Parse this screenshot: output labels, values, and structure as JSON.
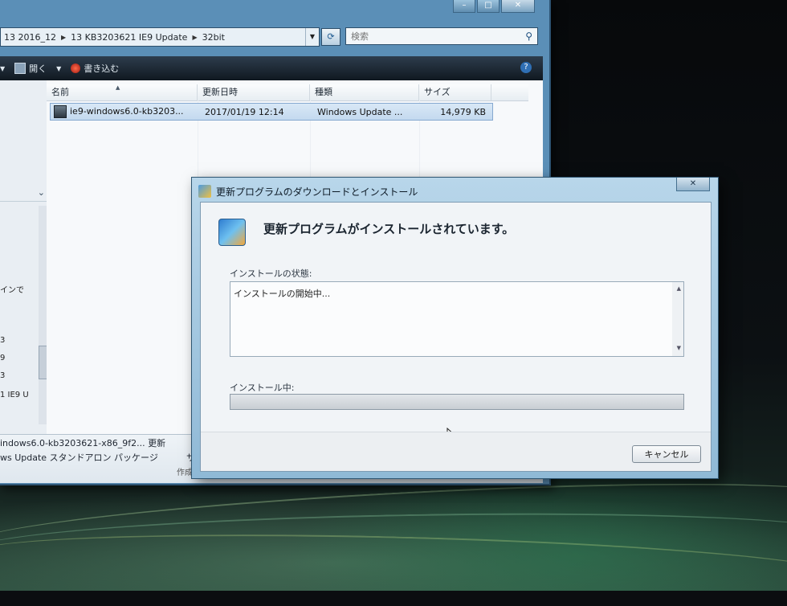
{
  "explorer": {
    "address": {
      "crumbs": [
        "13 2016_12",
        "13 KB3203621 IE9 Update",
        "32bit"
      ]
    },
    "search": {
      "placeholder": "検索"
    },
    "toolbar": {
      "open_label": "開く",
      "burn_label": "書き込む"
    },
    "columns": [
      "名前",
      "更新日時",
      "種類",
      "サイズ"
    ],
    "files": [
      {
        "name": "ie9-windows6.0-kb3203...",
        "modified": "2017/01/19 12:14",
        "type": "Windows Update ...",
        "size": "14,979 KB"
      }
    ],
    "nav_fragments": [
      "インで",
      "3",
      "9",
      "3",
      "1 IE9 U"
    ],
    "details": {
      "line1": "indows6.0-kb3203621-x86_9f2... 更新",
      "line2": "ws Update スタンドアロン パッケージ",
      "line2_extra": "サ",
      "line3": "作成"
    }
  },
  "dialog": {
    "title": "更新プログラムのダウンロードとインストール",
    "header": "更新プログラムがインストールされています。",
    "status_label": "インストールの状態:",
    "status_text": "インストールの開始中...",
    "progress_label": "インストール中:",
    "progress": 0,
    "cancel_label": "キャンセル"
  }
}
